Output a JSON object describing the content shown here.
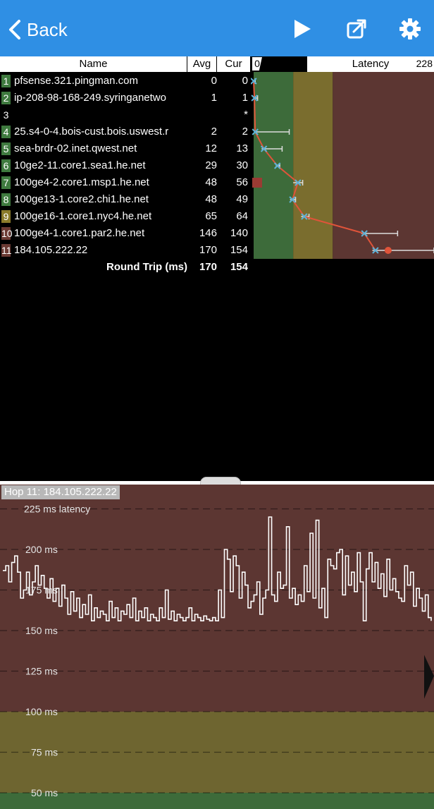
{
  "nav": {
    "back_label": "Back",
    "icons": [
      "chevron-left-icon",
      "play-icon",
      "share-icon",
      "gear-icon"
    ]
  },
  "table": {
    "headers": {
      "name": "Name",
      "avg": "Avg",
      "cur": "Cur",
      "latency": "Latency",
      "latency_min": "0",
      "latency_max": "228"
    },
    "hops": [
      {
        "n": "1",
        "name": "pfsense.321.pingman.com",
        "avg": "0",
        "cur": "0",
        "color": "#3f7a3f"
      },
      {
        "n": "2",
        "name": "ip-208-98-168-249.syringanetwo",
        "avg": "1",
        "cur": "1",
        "color": "#3f7a3f"
      },
      {
        "n": "3",
        "name": "",
        "avg": "",
        "cur": "*",
        "color": ""
      },
      {
        "n": "4",
        "name": "25.s4-0-4.bois-cust.bois.uswest.r",
        "avg": "2",
        "cur": "2",
        "color": "#3f7a3f"
      },
      {
        "n": "5",
        "name": "sea-brdr-02.inet.qwest.net",
        "avg": "12",
        "cur": "13",
        "color": "#3f7a3f"
      },
      {
        "n": "6",
        "name": "10ge2-11.core1.sea1.he.net",
        "avg": "29",
        "cur": "30",
        "color": "#3f7a3f"
      },
      {
        "n": "7",
        "name": "100ge4-2.core1.msp1.he.net",
        "avg": "48",
        "cur": "56",
        "color": "#3f7a3f"
      },
      {
        "n": "8",
        "name": "100ge13-1.core2.chi1.he.net",
        "avg": "48",
        "cur": "49",
        "color": "#3f7a3f"
      },
      {
        "n": "9",
        "name": "100ge16-1.core1.nyc4.he.net",
        "avg": "65",
        "cur": "64",
        "color": "#8a7b2a"
      },
      {
        "n": "10",
        "name": "100ge4-1.core1.par2.he.net",
        "avg": "146",
        "cur": "140",
        "color": "#6b3a33"
      },
      {
        "n": "11",
        "name": "184.105.222.22",
        "avg": "170",
        "cur": "154",
        "color": "#6b3a33"
      }
    ],
    "round_trip": {
      "label": "Round Trip (ms)",
      "avg": "170",
      "cur": "154"
    }
  },
  "latency_chart": {
    "max": 228,
    "zones": [
      {
        "from": 0,
        "to": 50,
        "color": "#3d6b3a"
      },
      {
        "from": 50,
        "to": 100,
        "color": "#7a6d2e"
      },
      {
        "from": 100,
        "to": 228,
        "color": "#5c3632"
      }
    ],
    "points": [
      {
        "hop": 1,
        "cur": 0,
        "min": 0,
        "max": 2
      },
      {
        "hop": 2,
        "cur": 1,
        "min": 0,
        "max": 5
      },
      {
        "hop": 4,
        "cur": 2,
        "min": 1,
        "max": 45
      },
      {
        "hop": 5,
        "cur": 13,
        "min": 10,
        "max": 36
      },
      {
        "hop": 6,
        "cur": 30,
        "min": 28,
        "max": 33
      },
      {
        "hop": 7,
        "cur": 56,
        "min": 50,
        "max": 62
      },
      {
        "hop": 8,
        "cur": 49,
        "min": 46,
        "max": 53
      },
      {
        "hop": 9,
        "cur": 64,
        "min": 60,
        "max": 70
      },
      {
        "hop": 10,
        "cur": 140,
        "min": 136,
        "max": 182
      },
      {
        "hop": 11,
        "cur": 154,
        "min": 150,
        "max": 228
      }
    ],
    "loss_marker_hop": 7,
    "colors": {
      "line": "#e0543a",
      "marker": "#5fb3d8",
      "error": "#dddddd",
      "loss": "#9b3b33"
    }
  },
  "graph": {
    "title": "Hop 11: 184.105.222.22",
    "ms_min": 40,
    "ms_max": 240,
    "zones": [
      {
        "from": 0,
        "to": 50,
        "color": "#3d6b3a"
      },
      {
        "from": 50,
        "to": 100,
        "color": "#6e6530"
      },
      {
        "from": 100,
        "to": 240,
        "color": "#5c3632"
      }
    ],
    "gridlines": [
      {
        "ms": 225,
        "label": "225 ms latency"
      },
      {
        "ms": 200,
        "label": "200 ms"
      },
      {
        "ms": 175,
        "label": "175 ms"
      },
      {
        "ms": 150,
        "label": "150 ms"
      },
      {
        "ms": 125,
        "label": "125 ms"
      },
      {
        "ms": 100,
        "label": "100 ms"
      },
      {
        "ms": 75,
        "label": "75 ms"
      },
      {
        "ms": 50,
        "label": "50 ms"
      }
    ],
    "trace": [
      187,
      190,
      180,
      192,
      196,
      186,
      170,
      175,
      186,
      172,
      180,
      190,
      178,
      184,
      176,
      170,
      182,
      168,
      176,
      165,
      178,
      170,
      160,
      174,
      162,
      170,
      158,
      166,
      160,
      172,
      156,
      164,
      158,
      162,
      160,
      156,
      168,
      158,
      164,
      156,
      162,
      160,
      166,
      158,
      170,
      156,
      162,
      158,
      164,
      156,
      160,
      158,
      156,
      164,
      158,
      175,
      157,
      162,
      156,
      160,
      158,
      156,
      158,
      164,
      156,
      160,
      158,
      156,
      159,
      157,
      156,
      158,
      156,
      175,
      158,
      200,
      194,
      174,
      196,
      190,
      170,
      186,
      178,
      164,
      168,
      172,
      180,
      160,
      170,
      175,
      220,
      172,
      168,
      186,
      176,
      178,
      214,
      170,
      176,
      166,
      172,
      168,
      190,
      174,
      210,
      170,
      218,
      164,
      176,
      158,
      194,
      190,
      188,
      198,
      200,
      172,
      196,
      178,
      186,
      174,
      198,
      180,
      156,
      188,
      198,
      180,
      192,
      176,
      185,
      171,
      194,
      175,
      182,
      174,
      170,
      168,
      190,
      178,
      186,
      165,
      176,
      170,
      162,
      172,
      158,
      156
    ],
    "arrow_color": "#111111"
  }
}
